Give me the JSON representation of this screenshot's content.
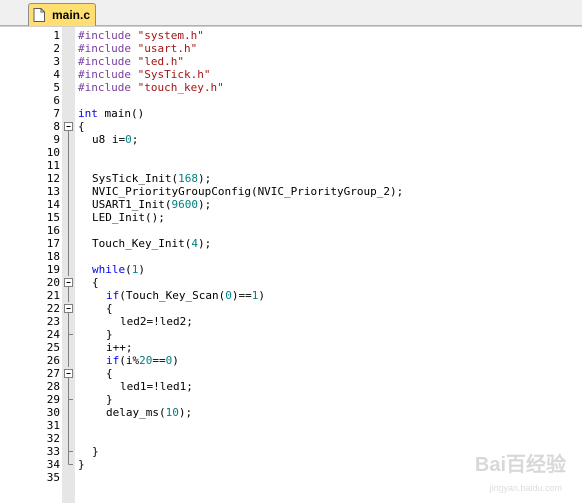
{
  "tab": {
    "label": "main.c",
    "icon": "file-icon"
  },
  "watermark": {
    "text": "Bai百经验",
    "sub": "jingyan.baidu.com"
  },
  "colors": {
    "preprocessor": "#7a3e9d",
    "string": "#a31515",
    "keyword": "#0000ff",
    "number": "#008080",
    "fold_bg": "#e6e6e6",
    "tab_bg": "#ffdf72"
  },
  "lines": [
    {
      "num": "1",
      "fold": "",
      "indent": 0,
      "tokens": [
        {
          "t": "#include ",
          "k": "pp"
        },
        {
          "t": "\"system.h\"",
          "k": "str"
        }
      ]
    },
    {
      "num": "2",
      "fold": "",
      "indent": 0,
      "tokens": [
        {
          "t": "#include ",
          "k": "pp"
        },
        {
          "t": "\"usart.h\"",
          "k": "str"
        }
      ]
    },
    {
      "num": "3",
      "fold": "",
      "indent": 0,
      "tokens": [
        {
          "t": "#include ",
          "k": "pp"
        },
        {
          "t": "\"led.h\"",
          "k": "str"
        }
      ]
    },
    {
      "num": "4",
      "fold": "",
      "indent": 0,
      "tokens": [
        {
          "t": "#include ",
          "k": "pp"
        },
        {
          "t": "\"SysTick.h\"",
          "k": "str"
        }
      ]
    },
    {
      "num": "5",
      "fold": "",
      "indent": 0,
      "tokens": [
        {
          "t": "#include ",
          "k": "pp"
        },
        {
          "t": "\"touch_key.h\"",
          "k": "str"
        }
      ]
    },
    {
      "num": "6",
      "fold": "",
      "indent": 0,
      "tokens": []
    },
    {
      "num": "7",
      "fold": "",
      "indent": 0,
      "tokens": [
        {
          "t": "int",
          "k": "kw"
        },
        {
          "t": " main()",
          "k": "plain"
        }
      ]
    },
    {
      "num": "8",
      "fold": "box",
      "indent": 0,
      "tokens": [
        {
          "t": "{",
          "k": "plain"
        }
      ]
    },
    {
      "num": "9",
      "fold": "line",
      "indent": 1,
      "tokens": [
        {
          "t": "u8 i=",
          "k": "plain"
        },
        {
          "t": "0",
          "k": "num"
        },
        {
          "t": ";",
          "k": "plain"
        }
      ]
    },
    {
      "num": "10",
      "fold": "line",
      "indent": 0,
      "tokens": []
    },
    {
      "num": "11",
      "fold": "line",
      "indent": 0,
      "tokens": []
    },
    {
      "num": "12",
      "fold": "line",
      "indent": 1,
      "tokens": [
        {
          "t": "SysTick_Init(",
          "k": "plain"
        },
        {
          "t": "168",
          "k": "num"
        },
        {
          "t": ");",
          "k": "plain"
        }
      ]
    },
    {
      "num": "13",
      "fold": "line",
      "indent": 1,
      "tokens": [
        {
          "t": "NVIC_PriorityGroupConfig(NVIC_PriorityGroup_2);",
          "k": "plain"
        }
      ]
    },
    {
      "num": "14",
      "fold": "line",
      "indent": 1,
      "tokens": [
        {
          "t": "USART1_Init(",
          "k": "plain"
        },
        {
          "t": "9600",
          "k": "num"
        },
        {
          "t": ");",
          "k": "plain"
        }
      ]
    },
    {
      "num": "15",
      "fold": "line",
      "indent": 1,
      "tokens": [
        {
          "t": "LED_Init();",
          "k": "plain"
        }
      ]
    },
    {
      "num": "16",
      "fold": "line",
      "indent": 0,
      "tokens": []
    },
    {
      "num": "17",
      "fold": "line",
      "indent": 1,
      "tokens": [
        {
          "t": "Touch_Key_Init(",
          "k": "plain"
        },
        {
          "t": "4",
          "k": "num"
        },
        {
          "t": ");",
          "k": "plain"
        }
      ]
    },
    {
      "num": "18",
      "fold": "line",
      "indent": 0,
      "tokens": []
    },
    {
      "num": "19",
      "fold": "line",
      "indent": 1,
      "tokens": [
        {
          "t": "while",
          "k": "kw"
        },
        {
          "t": "(",
          "k": "plain"
        },
        {
          "t": "1",
          "k": "num"
        },
        {
          "t": ")",
          "k": "plain"
        }
      ]
    },
    {
      "num": "20",
      "fold": "box",
      "indent": 1,
      "tokens": [
        {
          "t": "{",
          "k": "plain"
        }
      ]
    },
    {
      "num": "21",
      "fold": "line",
      "indent": 2,
      "tokens": [
        {
          "t": "if",
          "k": "kw"
        },
        {
          "t": "(Touch_Key_Scan(",
          "k": "plain"
        },
        {
          "t": "0",
          "k": "num"
        },
        {
          "t": ")==",
          "k": "plain"
        },
        {
          "t": "1",
          "k": "num"
        },
        {
          "t": ")",
          "k": "plain"
        }
      ]
    },
    {
      "num": "22",
      "fold": "box",
      "indent": 2,
      "tokens": [
        {
          "t": "{",
          "k": "plain"
        }
      ]
    },
    {
      "num": "23",
      "fold": "line",
      "indent": 3,
      "tokens": [
        {
          "t": "led2=!led2;",
          "k": "plain"
        }
      ]
    },
    {
      "num": "24",
      "fold": "end",
      "indent": 2,
      "tokens": [
        {
          "t": "}",
          "k": "plain"
        }
      ]
    },
    {
      "num": "25",
      "fold": "line",
      "indent": 2,
      "tokens": [
        {
          "t": "i++;",
          "k": "plain"
        }
      ]
    },
    {
      "num": "26",
      "fold": "line",
      "indent": 2,
      "tokens": [
        {
          "t": "if",
          "k": "kw"
        },
        {
          "t": "(i%",
          "k": "plain"
        },
        {
          "t": "20",
          "k": "num"
        },
        {
          "t": "==",
          "k": "plain"
        },
        {
          "t": "0",
          "k": "num"
        },
        {
          "t": ")",
          "k": "plain"
        }
      ]
    },
    {
      "num": "27",
      "fold": "box",
      "indent": 2,
      "tokens": [
        {
          "t": "{",
          "k": "plain"
        }
      ]
    },
    {
      "num": "28",
      "fold": "line",
      "indent": 3,
      "tokens": [
        {
          "t": "led1=!led1;",
          "k": "plain"
        }
      ]
    },
    {
      "num": "29",
      "fold": "end",
      "indent": 2,
      "tokens": [
        {
          "t": "}",
          "k": "plain"
        }
      ]
    },
    {
      "num": "30",
      "fold": "line",
      "indent": 2,
      "tokens": [
        {
          "t": "delay_ms(",
          "k": "plain"
        },
        {
          "t": "10",
          "k": "num"
        },
        {
          "t": ");",
          "k": "plain"
        }
      ]
    },
    {
      "num": "31",
      "fold": "line",
      "indent": 0,
      "tokens": []
    },
    {
      "num": "32",
      "fold": "line",
      "indent": 0,
      "tokens": []
    },
    {
      "num": "33",
      "fold": "end",
      "indent": 1,
      "tokens": [
        {
          "t": "}",
          "k": "plain"
        }
      ]
    },
    {
      "num": "34",
      "fold": "end",
      "indent": 0,
      "tokens": [
        {
          "t": "}",
          "k": "plain"
        }
      ]
    },
    {
      "num": "35",
      "fold": "",
      "indent": 0,
      "tokens": []
    }
  ]
}
